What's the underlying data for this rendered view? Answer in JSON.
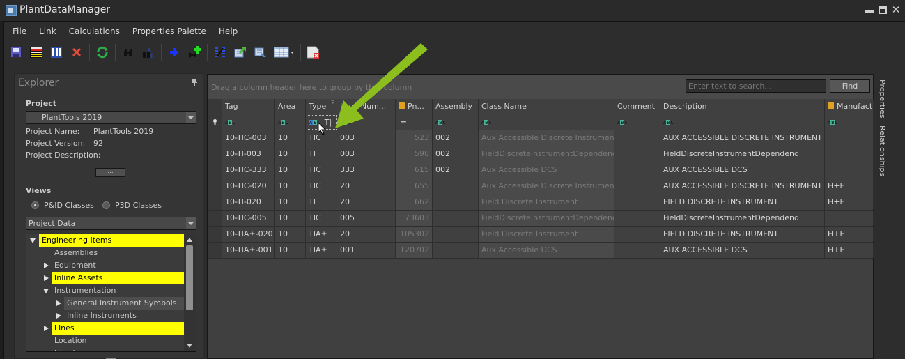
{
  "window": {
    "title": "PlantDataManager",
    "controls": [
      "minimize",
      "maximize",
      "close"
    ]
  },
  "menu": [
    "File",
    "Link",
    "Calculations",
    "Properties Palette",
    "Help"
  ],
  "toolbar": [
    {
      "icon": "save-icon"
    },
    {
      "icon": "row-list-icon"
    },
    {
      "icon": "column-list-icon"
    },
    {
      "icon": "delete-icon"
    },
    {
      "icon": "refresh-icon"
    },
    {
      "icon": "find-icon"
    },
    {
      "icon": "find-replace-icon"
    },
    {
      "icon": "add-icon"
    },
    {
      "icon": "add-valve-icon"
    },
    {
      "icon": "split-icon"
    },
    {
      "icon": "export-icon"
    },
    {
      "icon": "import-icon"
    },
    {
      "icon": "table-view-icon"
    },
    {
      "icon": "close-document-icon"
    }
  ],
  "explorer": {
    "title": "Explorer",
    "project_label": "Project",
    "project_selected": "PlantTools 2019",
    "project_name_label": "Project Name:",
    "project_name": "PlantTools 2019",
    "project_version_label": "Project Version:",
    "project_version": "92",
    "project_description_label": "Project Description:",
    "ellipsis_button": "...",
    "views_label": "Views",
    "view_options": [
      {
        "label": "P&ID Classes",
        "selected": true
      },
      {
        "label": "P3D Classes",
        "selected": false
      }
    ],
    "data_selected": "Project Data",
    "tree": [
      {
        "label": "Engineering Items",
        "level": 0,
        "expander": "expanded",
        "highlight": true
      },
      {
        "label": "Assemblies",
        "level": 1,
        "expander": "none",
        "highlight": false
      },
      {
        "label": "Equipment",
        "level": 1,
        "expander": "collapsed",
        "highlight": false
      },
      {
        "label": "Inline Assets",
        "level": 1,
        "expander": "collapsed",
        "highlight": true
      },
      {
        "label": "Instrumentation",
        "level": 1,
        "expander": "expanded",
        "highlight": false
      },
      {
        "label": "General Instrument Symbols",
        "level": 2,
        "expander": "collapsed",
        "highlight": false,
        "selected": true
      },
      {
        "label": "Inline Instruments",
        "level": 2,
        "expander": "collapsed",
        "highlight": false
      },
      {
        "label": "Lines",
        "level": 1,
        "expander": "collapsed",
        "highlight": true
      },
      {
        "label": "Location",
        "level": 1,
        "expander": "none",
        "highlight": false
      },
      {
        "label": "Nozzles",
        "level": 1,
        "expander": "collapsed",
        "highlight": false
      }
    ]
  },
  "grid": {
    "group_hint": "Drag a column header here to group by that column",
    "search_placeholder": "Enter text to search...",
    "find_button": "Find",
    "columns": [
      "Tag",
      "Area",
      "Type",
      "Loop Num...",
      "Pn...",
      "Assembly",
      "Class Name",
      "Comment",
      "Description",
      "Manufact..."
    ],
    "type_filter_value": "T",
    "rows": [
      [
        "10-TIC-003",
        "10",
        "TIC",
        "003",
        "523",
        "002",
        "Aux Accessible Discrete Instrument",
        "",
        "AUX ACCESSIBLE DISCRETE INSTRUMENT",
        ""
      ],
      [
        "10-TI-003",
        "10",
        "TI",
        "003",
        "598",
        "002",
        "FieldDiscreteInstrumentDependend",
        "",
        "FieldDiscreteInstrumentDependend",
        ""
      ],
      [
        "10-TIC-333",
        "10",
        "TIC",
        "333",
        "615",
        "002",
        "Aux Accessible DCS",
        "",
        "AUX ACCESSIBLE DCS",
        ""
      ],
      [
        "10-TIC-020",
        "10",
        "TIC",
        "20",
        "655",
        "",
        "Aux Accessible Discrete Instrument",
        "",
        "AUX ACCESSIBLE DISCRETE INSTRUMENT",
        "H+E"
      ],
      [
        "10-TI-020",
        "10",
        "TI",
        "20",
        "662",
        "",
        "Field Discrete Instrument",
        "",
        "FIELD DISCRETE INSTRUMENT",
        "H+E"
      ],
      [
        "10-TIC-005",
        "10",
        "TIC",
        "005",
        "73603",
        "",
        "FieldDiscreteInstrumentDependend",
        "",
        "FieldDiscreteInstrumentDependend",
        ""
      ],
      [
        "10-TIA±-020",
        "10",
        "TIA±",
        "20",
        "105302",
        "",
        "Field Discrete Instrument",
        "",
        "FIELD DISCRETE INSTRUMENT",
        "H+E"
      ],
      [
        "10-TIA±-001",
        "10",
        "TIA±",
        "001",
        "120702",
        "",
        "Aux Accessible DCS",
        "",
        "AUX ACCESSIBLE DCS",
        "H+E"
      ]
    ]
  },
  "side_tabs": [
    "Properties",
    "Relationships"
  ],
  "colors": {
    "highlight": "#ffff00",
    "annotation_arrow": "#8cbf1e",
    "filter_badge": "#49b39a"
  }
}
